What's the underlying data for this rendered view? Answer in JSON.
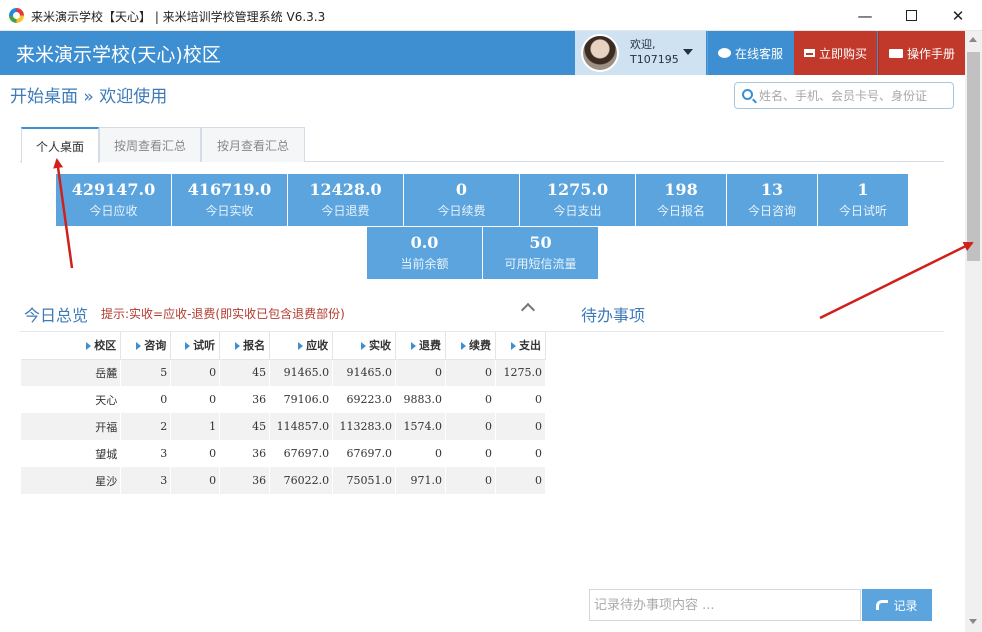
{
  "window": {
    "title": "来米演示学校【天心】 | 来米培训学校管理系统 V6.3.3",
    "min_glyph": "—",
    "close_glyph": "✕"
  },
  "header": {
    "school_name": "来米演示学校(天心)校区",
    "user": {
      "greeting": "欢迎,",
      "id": "T107195"
    },
    "buttons": {
      "service": "在线客服",
      "buy": "立即购买",
      "manual": "操作手册"
    }
  },
  "breadcrumb": "开始桌面 » 欢迎使用",
  "search": {
    "placeholder": "姓名、手机、会员卡号、身份证"
  },
  "tabs": [
    {
      "label": "个人桌面",
      "active": true
    },
    {
      "label": "按周查看汇总",
      "active": false
    },
    {
      "label": "按月查看汇总",
      "active": false
    }
  ],
  "stats": [
    {
      "value": "429147.0",
      "label": "今日应收"
    },
    {
      "value": "416719.0",
      "label": "今日实收"
    },
    {
      "value": "12428.0",
      "label": "今日退费"
    },
    {
      "value": "0",
      "label": "今日续费"
    },
    {
      "value": "1275.0",
      "label": "今日支出"
    },
    {
      "value": "198",
      "label": "今日报名"
    },
    {
      "value": "13",
      "label": "今日咨询"
    },
    {
      "value": "1",
      "label": "今日试听"
    },
    {
      "value": "0.0",
      "label": "当前余额"
    },
    {
      "value": "50",
      "label": "可用短信流量"
    }
  ],
  "overview": {
    "title": "今日总览",
    "hint": "提示:实收=应收-退费(即实收已包含退费部份)",
    "columns": [
      "校区",
      "咨询",
      "试听",
      "报名",
      "应收",
      "实收",
      "退费",
      "续费",
      "支出"
    ],
    "rows": [
      [
        "岳麓",
        "5",
        "0",
        "45",
        "91465.0",
        "91465.0",
        "0",
        "0",
        "1275.0"
      ],
      [
        "天心",
        "0",
        "0",
        "36",
        "79106.0",
        "69223.0",
        "9883.0",
        "0",
        "0"
      ],
      [
        "开福",
        "2",
        "1",
        "45",
        "114857.0",
        "113283.0",
        "1574.0",
        "0",
        "0"
      ],
      [
        "望城",
        "3",
        "0",
        "36",
        "67697.0",
        "67697.0",
        "0",
        "0",
        "0"
      ],
      [
        "星沙",
        "3",
        "0",
        "36",
        "76022.0",
        "75051.0",
        "971.0",
        "0",
        "0"
      ]
    ]
  },
  "todo": {
    "title": "待办事项",
    "placeholder": "记录待办事项内容 ...",
    "record_label": "记录"
  },
  "colors": {
    "header_bg": "#3d8fd1",
    "stat_bg": "#5ba4de",
    "buy_bg": "#c0392b",
    "arrow": "#d0201c"
  }
}
